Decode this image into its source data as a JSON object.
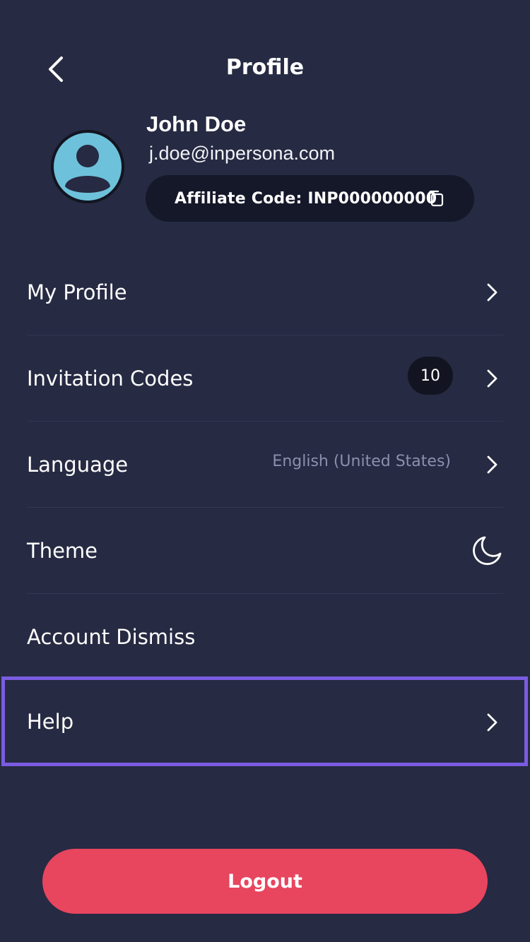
{
  "header": {
    "title": "Profile",
    "back_icon": "chevron-left-icon"
  },
  "user": {
    "name": "John Doe",
    "email": "j.doe@inpersona.com",
    "avatar_icon": "user-avatar-icon",
    "affiliate_code_label": "Affiliate Code: INP000000000",
    "copy_icon": "copy-icon"
  },
  "menu": {
    "my_profile": {
      "label": "My Profile"
    },
    "invitation_codes": {
      "label": "Invitation Codes",
      "badge": "10"
    },
    "language": {
      "label": "Language",
      "value": "English (United States)"
    },
    "theme": {
      "label": "Theme",
      "icon": "moon-icon"
    },
    "account_dismiss": {
      "label": "Account Dismiss"
    },
    "help": {
      "label": "Help"
    }
  },
  "logout": {
    "label": "Logout"
  },
  "colors": {
    "background": "#262A42",
    "pill_background": "#151829",
    "logout": "#E8455F",
    "highlight": "#7A5CE0",
    "avatar": "#6EC1DA",
    "secondary_text": "#8A90AE"
  }
}
